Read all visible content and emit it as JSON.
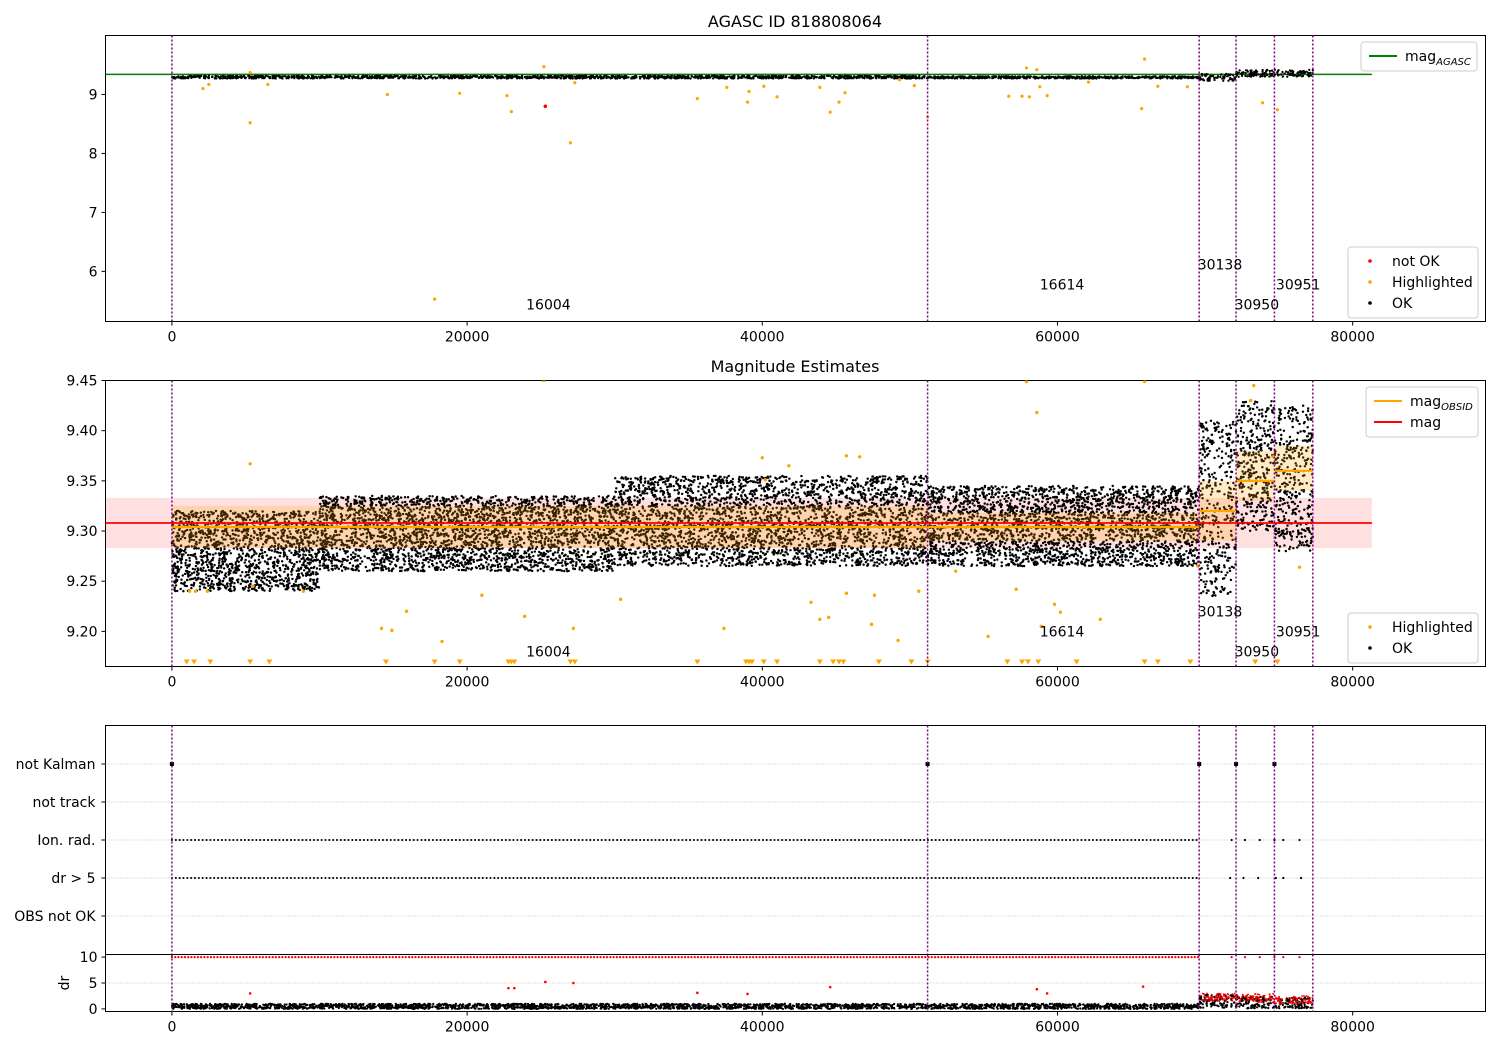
{
  "chart_data": [
    {
      "type": "scatter",
      "title": "AGASC ID 818808064",
      "xlim": [
        -4500,
        89000
      ],
      "ylim": [
        5.15,
        10.0
      ],
      "xticks": [
        0,
        20000,
        40000,
        60000,
        80000
      ],
      "yticks": [
        6,
        7,
        8,
        9
      ],
      "obsid_boundaries": [
        0,
        51200,
        69600,
        72100,
        74700,
        77300
      ],
      "obsid_labels": [
        {
          "text": "16004",
          "x": 24000,
          "y": 5.35
        },
        {
          "text": "16614",
          "x": 58800,
          "y": 5.69
        },
        {
          "text": "30138",
          "x": 69500,
          "y": 6.03
        },
        {
          "text": "30950",
          "x": 72000,
          "y": 5.35
        },
        {
          "text": "30951",
          "x": 74800,
          "y": 5.69
        }
      ],
      "reference_line": {
        "name": "mag$_{AGASC}$",
        "display": "mag",
        "subscript": "AGASC",
        "value": 9.34,
        "x": [
          -4500,
          81300
        ],
        "color": "#008000"
      },
      "ok_band": {
        "segments": [
          [
            0,
            51200,
            9.27,
            9.32
          ],
          [
            51200,
            69600,
            9.27,
            9.31
          ],
          [
            69600,
            72100,
            9.23,
            9.35
          ],
          [
            72100,
            77300,
            9.3,
            9.42
          ]
        ]
      },
      "highlighted_points": [
        [
          2100,
          9.1
        ],
        [
          2500,
          9.17
        ],
        [
          5300,
          8.52
        ],
        [
          5300,
          9.37
        ],
        [
          6500,
          9.17
        ],
        [
          14600,
          9.0
        ],
        [
          17800,
          5.53
        ],
        [
          19500,
          9.02
        ],
        [
          22700,
          8.98
        ],
        [
          23000,
          8.71
        ],
        [
          25200,
          9.47
        ],
        [
          27000,
          8.18
        ],
        [
          27300,
          9.2
        ],
        [
          35600,
          8.93
        ],
        [
          37600,
          9.12
        ],
        [
          39000,
          8.87
        ],
        [
          39100,
          9.05
        ],
        [
          40100,
          9.14
        ],
        [
          41000,
          8.96
        ],
        [
          43900,
          9.12
        ],
        [
          44600,
          8.7
        ],
        [
          45200,
          8.87
        ],
        [
          45600,
          9.03
        ],
        [
          49300,
          9.25
        ],
        [
          50300,
          9.15
        ],
        [
          51200,
          8.62
        ],
        [
          56700,
          8.97
        ],
        [
          57600,
          8.97
        ],
        [
          57900,
          9.45
        ],
        [
          58100,
          8.96
        ],
        [
          58600,
          9.42
        ],
        [
          58800,
          9.13
        ],
        [
          59300,
          8.98
        ],
        [
          62100,
          9.21
        ],
        [
          65900,
          9.6
        ],
        [
          65700,
          8.76
        ],
        [
          66800,
          9.14
        ],
        [
          68800,
          9.13
        ],
        [
          73900,
          8.86
        ],
        [
          74900,
          8.74
        ]
      ],
      "not_ok_points": [
        [
          25300,
          8.8
        ]
      ],
      "legend": {
        "entries": [
          {
            "name": "not OK",
            "color": "#ff0000"
          },
          {
            "name": "Highlighted",
            "color": "#ffa500"
          },
          {
            "name": "OK",
            "color": "#000000"
          }
        ],
        "placement": "lower right"
      }
    },
    {
      "type": "scatter",
      "title": "Magnitude Estimates",
      "xlim": [
        -4500,
        89000
      ],
      "ylim": [
        9.165,
        9.45
      ],
      "xticks": [
        0,
        20000,
        40000,
        60000,
        80000
      ],
      "yticks": [
        9.2,
        9.25,
        9.3,
        9.35,
        9.4,
        9.45
      ],
      "obsid_boundaries": [
        0,
        51200,
        69600,
        72100,
        74700,
        77300
      ],
      "obsid_labels": [
        {
          "text": "16004",
          "x": 24000,
          "y": 9.175
        },
        {
          "text": "16614",
          "x": 58800,
          "y": 9.195
        },
        {
          "text": "30138",
          "x": 69500,
          "y": 9.215
        },
        {
          "text": "30950",
          "x": 72000,
          "y": 9.175
        },
        {
          "text": "30951",
          "x": 74800,
          "y": 9.195
        }
      ],
      "mag_line": {
        "name": "mag",
        "value": 9.308,
        "band": [
          9.283,
          9.333
        ],
        "x": [
          -4500,
          81300
        ],
        "color": "#ff0000"
      },
      "mag_obsid": [
        {
          "x": [
            0,
            51200
          ],
          "value": 9.304,
          "band": [
            9.283,
            9.325
          ]
        },
        {
          "x": [
            51200,
            69600
          ],
          "value": 9.304,
          "band": [
            9.29,
            9.318
          ]
        },
        {
          "x": [
            69600,
            72100
          ],
          "value": 9.32,
          "band": [
            9.29,
            9.35
          ]
        },
        {
          "x": [
            72100,
            74700
          ],
          "value": 9.35,
          "band": [
            9.33,
            9.38
          ]
        },
        {
          "x": [
            74700,
            77300
          ],
          "value": 9.36,
          "band": [
            9.34,
            9.385
          ]
        }
      ],
      "ok_envelope": [
        {
          "x": [
            0,
            10000
          ],
          "y_low": 9.24,
          "y_high": 9.32
        },
        {
          "x": [
            10000,
            30000
          ],
          "y_low": 9.26,
          "y_high": 9.335
        },
        {
          "x": [
            30000,
            51200
          ],
          "y_low": 9.265,
          "y_high": 9.355
        },
        {
          "x": [
            51200,
            69600
          ],
          "y_low": 9.265,
          "y_high": 9.345
        },
        {
          "x": [
            69600,
            72100
          ],
          "y_low": 9.235,
          "y_high": 9.41
        },
        {
          "x": [
            72100,
            74700
          ],
          "y_low": 9.3,
          "y_high": 9.43
        },
        {
          "x": [
            74700,
            77300
          ],
          "y_low": 9.28,
          "y_high": 9.425
        }
      ],
      "highlighted_points": [
        [
          1200,
          9.24
        ],
        [
          1600,
          9.24
        ],
        [
          2400,
          9.24
        ],
        [
          5300,
          9.367
        ],
        [
          5500,
          9.245
        ],
        [
          8900,
          9.24
        ],
        [
          14200,
          9.203
        ],
        [
          14900,
          9.201
        ],
        [
          15900,
          9.22
        ],
        [
          18300,
          9.19
        ],
        [
          21000,
          9.236
        ],
        [
          23900,
          9.215
        ],
        [
          25200,
          9.45
        ],
        [
          27200,
          9.203
        ],
        [
          30400,
          9.232
        ],
        [
          37400,
          9.203
        ],
        [
          40000,
          9.373
        ],
        [
          40200,
          9.351
        ],
        [
          41800,
          9.365
        ],
        [
          43300,
          9.229
        ],
        [
          43900,
          9.212
        ],
        [
          44500,
          9.214
        ],
        [
          45700,
          9.238
        ],
        [
          45700,
          9.375
        ],
        [
          46600,
          9.374
        ],
        [
          47400,
          9.207
        ],
        [
          47600,
          9.236
        ],
        [
          49200,
          9.191
        ],
        [
          50600,
          9.24
        ],
        [
          53100,
          9.26
        ],
        [
          55300,
          9.195
        ],
        [
          57200,
          9.242
        ],
        [
          57900,
          9.449
        ],
        [
          58600,
          9.418
        ],
        [
          58900,
          9.205
        ],
        [
          59800,
          9.227
        ],
        [
          60200,
          9.219
        ],
        [
          62900,
          9.212
        ],
        [
          65900,
          9.449
        ],
        [
          69500,
          9.265
        ],
        [
          73100,
          9.43
        ],
        [
          73300,
          9.445
        ],
        [
          74600,
          9.374
        ],
        [
          76400,
          9.264
        ]
      ],
      "highlighted_below_range": [
        1000,
        1500,
        2600,
        5300,
        6600,
        14500,
        17800,
        19500,
        22800,
        23000,
        23200,
        27000,
        27300,
        35600,
        38900,
        39100,
        39300,
        40100,
        41000,
        43900,
        44800,
        45200,
        45500,
        47900,
        50100,
        51200,
        56600,
        57600,
        58000,
        58700,
        61300,
        65900,
        66800,
        69000,
        73400,
        74900
      ],
      "legend": {
        "entries": [
          {
            "name": "mag$_{OBSID}$",
            "display": "mag",
            "subscript": "OBSID",
            "color": "#ffa500"
          },
          {
            "name": "mag",
            "color": "#ff0000"
          },
          {
            "name": "Highlighted",
            "color": "#ffa500"
          },
          {
            "name": "OK",
            "color": "#000000"
          }
        ],
        "placement": "upper right / lower right"
      }
    },
    {
      "type": "scatter",
      "title": "",
      "xlim": [
        -4500,
        89000
      ],
      "categories": [
        "not Kalman",
        "not track",
        "Ion. rad.",
        "dr > 5",
        "OBS not OK"
      ],
      "flag_rows": [
        {
          "row": "not Kalman",
          "x": [
            0,
            51200,
            69600,
            72100,
            74700
          ]
        },
        {
          "row": "not track",
          "x": []
        },
        {
          "row": "Ion. rad.",
          "spans": [
            [
              0,
              69600
            ]
          ],
          "sparse_x": [
            71800,
            72700,
            73700,
            74700,
            75300,
            76400
          ]
        },
        {
          "row": "dr > 5",
          "spans": [
            [
              0,
              69600
            ]
          ],
          "sparse_x": [
            71700,
            72600,
            73600,
            74800,
            75300,
            76500
          ]
        },
        {
          "row": "OBS not OK",
          "x": []
        }
      ],
      "obsid_boundaries": [
        0,
        51200,
        69600,
        72100,
        74700,
        77300
      ]
    },
    {
      "type": "scatter",
      "title": "",
      "xlim": [
        -4500,
        89000
      ],
      "ylim": [
        -0.5,
        10.5
      ],
      "xticks": [
        0,
        20000,
        40000,
        60000,
        80000
      ],
      "yticks": [
        0,
        5,
        10
      ],
      "ylabel": "dr",
      "dr_capped_value": 10,
      "dr_capped_spans": [
        [
          0,
          69600
        ]
      ],
      "dr_capped_sparse_x": [
        71800,
        72700,
        73700,
        74700,
        75300,
        76400
      ],
      "dr_ok_envelope": [
        {
          "x": [
            0,
            69600
          ],
          "y_low": 0.0,
          "y_high": 1.0
        },
        {
          "x": [
            69600,
            72100
          ],
          "y_low": 0.2,
          "y_high": 2.8
        },
        {
          "x": [
            72100,
            74700
          ],
          "y_low": 0.1,
          "y_high": 2.5
        },
        {
          "x": [
            74700,
            77300
          ],
          "y_low": 0.1,
          "y_high": 2.2
        }
      ],
      "dr_red_points": [
        [
          5300,
          3.0
        ],
        [
          22800,
          4.0
        ],
        [
          23200,
          4.0
        ],
        [
          25300,
          5.2
        ],
        [
          27200,
          5.0
        ],
        [
          35600,
          3.1
        ],
        [
          39000,
          2.9
        ],
        [
          44600,
          4.2
        ],
        [
          58600,
          3.8
        ],
        [
          59300,
          3.0
        ],
        [
          65800,
          4.3
        ]
      ],
      "obsid_boundaries": [
        0,
        51200,
        69600,
        72100,
        74700,
        77300
      ]
    }
  ]
}
